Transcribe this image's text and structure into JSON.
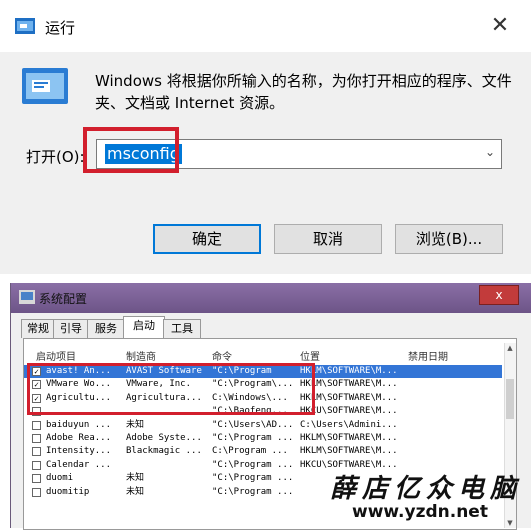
{
  "run_dialog": {
    "title": "运行",
    "close": "✕",
    "description": "Windows 将根据你所输入的名称，为你打开相应的程序、文件夹、文档或 Internet 资源。",
    "open_label": "打开(O):",
    "command": "msconfig",
    "buttons": {
      "ok": "确定",
      "cancel": "取消",
      "browse": "浏览(B)..."
    },
    "colors": {
      "selection": "#0078d7",
      "highlight": "#d21f2d"
    }
  },
  "sys_config": {
    "title": "系统配置",
    "close": "x",
    "tabs": [
      "常规",
      "引导",
      "服务",
      "启动",
      "工具"
    ],
    "active_tab": 3,
    "columns": [
      "启动项目",
      "制造商",
      "命令",
      "位置",
      "禁用日期"
    ],
    "rows": [
      {
        "checked": "✓",
        "item": "avast! An...",
        "maker": "AVAST Software",
        "command": "\"C:\\Program",
        "location": "HKLM\\SOFTWARE\\M...",
        "selected": true
      },
      {
        "checked": "✓",
        "item": "VMware Wo...",
        "maker": "VMware, Inc.",
        "command": "\"C:\\Program\\...",
        "location": "HKLM\\SOFTWARE\\M..."
      },
      {
        "checked": "✓",
        "item": "Agricultu...",
        "maker": "Agricultura...",
        "command": "C:\\Windows\\...",
        "location": "HKLM\\SOFTWARE\\M..."
      },
      {
        "checked": "",
        "item": "",
        "maker": "",
        "command": "\"C:\\Baofeng...",
        "location": "HKCU\\SOFTWARE\\M..."
      },
      {
        "checked": "",
        "item": "baiduyun ...",
        "maker": "未知",
        "command": "\"C:\\Users\\AD...",
        "location": "C:\\Users\\Admini..."
      },
      {
        "checked": "",
        "item": "Adobe Rea...",
        "maker": "Adobe Syste...",
        "command": "\"C:\\Program ...",
        "location": "HKLM\\SOFTWARE\\M..."
      },
      {
        "checked": "",
        "item": "Intensity...",
        "maker": "Blackmagic ...",
        "command": "C:\\Program ...",
        "location": "HKLM\\SOFTWARE\\M..."
      },
      {
        "checked": "",
        "item": "Calendar ...",
        "maker": "",
        "command": "\"C:\\Program ...",
        "location": "HKCU\\SOFTWARE\\M..."
      },
      {
        "checked": "",
        "item": "duomi",
        "maker": "未知",
        "command": "\"C:\\Program ...",
        "location": ""
      },
      {
        "checked": "",
        "item": "duomitip",
        "maker": "未知",
        "command": "\"C:\\Program ...",
        "location": ""
      }
    ],
    "colors": {
      "selected_row": "#3375d6",
      "titlebar": "#7a5f96"
    }
  },
  "watermark": {
    "line1": "薛店亿众电脑",
    "line2": "www.yzdn.net"
  }
}
